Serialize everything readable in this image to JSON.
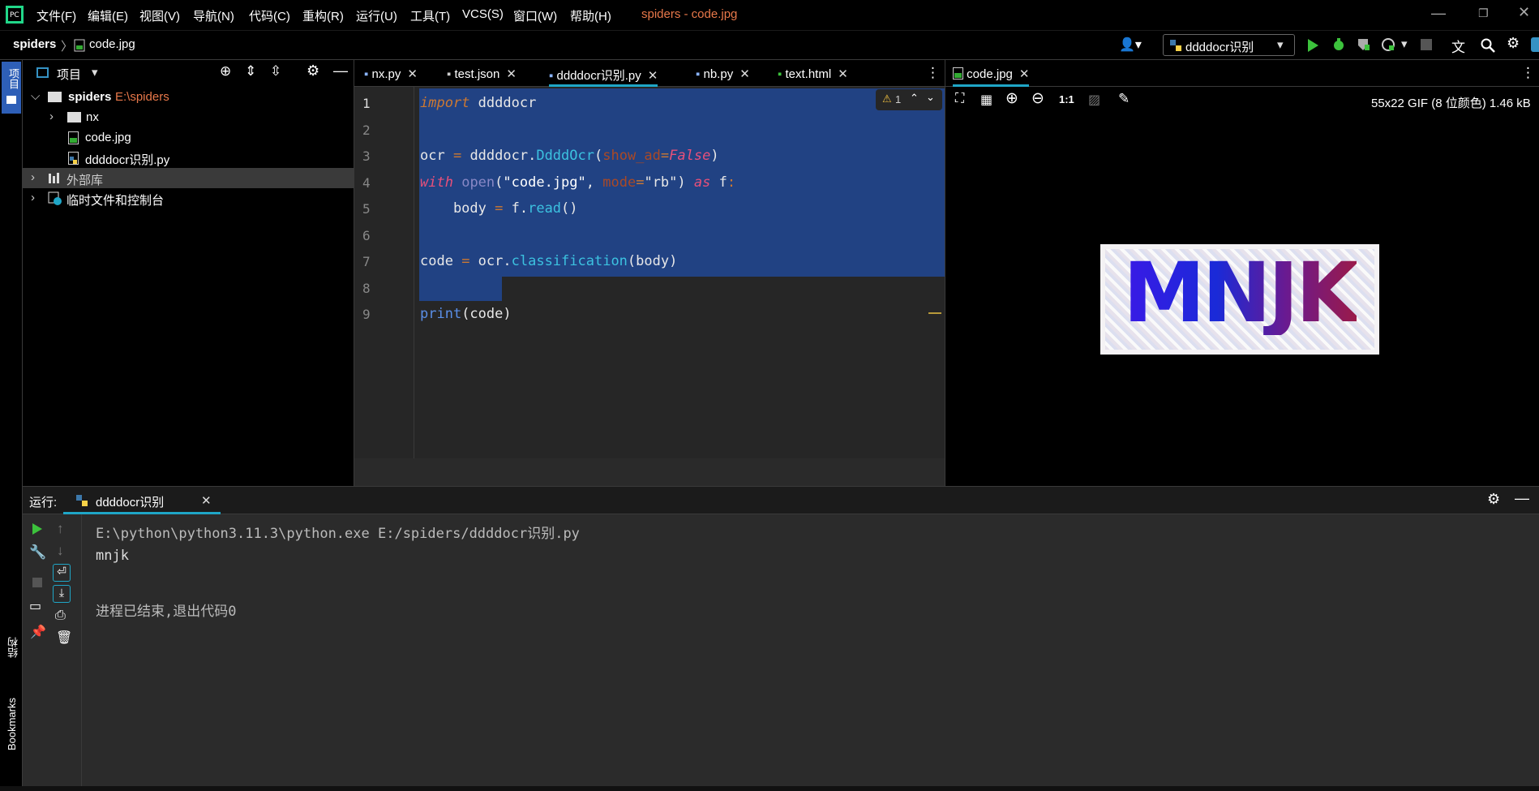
{
  "menu": [
    "文件(F)",
    "编辑(E)",
    "视图(V)",
    "导航(N)",
    "代码(C)",
    "重构(R)",
    "运行(U)",
    "工具(T)",
    "VCS(S)",
    "窗口(W)",
    "帮助(H)"
  ],
  "window_title": "spiders - code.jpg",
  "breadcrumb": {
    "root": "spiders",
    "file": "code.jpg"
  },
  "run_config": "ddddocr识别",
  "sidebar_left": {
    "project_tab": "项目",
    "structure_tab": "结构",
    "bookmarks_tab": "Bookmarks"
  },
  "project": {
    "title": "项目",
    "items": [
      {
        "label": "spiders",
        "path": "E:\\spiders"
      },
      {
        "label": "nx"
      },
      {
        "label": "code.jpg"
      },
      {
        "label": "ddddocr识别.py"
      },
      {
        "label": "外部库"
      },
      {
        "label": "临时文件和控制台"
      }
    ]
  },
  "editor": {
    "tabs": [
      "nx.py",
      "test.json",
      "ddddocr识别.py",
      "nb.py",
      "text.html"
    ],
    "warning_count": "1",
    "line_numbers": [
      "1",
      "2",
      "3",
      "4",
      "5",
      "6",
      "7",
      "8",
      "9"
    ]
  },
  "viewer": {
    "tab": "code.jpg",
    "zoom_actual": "1:1",
    "info": "55x22 GIF (8 位颜色) 1.46 kB",
    "captcha_text": "MNJK"
  },
  "run": {
    "label": "运行:",
    "tab": "ddddocr识别",
    "output": [
      "E:\\python\\python3.11.3\\python.exe E:/spiders/ddddocr识别.py",
      "mnjk",
      "",
      "进程已结束,退出代码0"
    ]
  },
  "colors": {
    "accent": "#3592c4",
    "selection": "#214283",
    "keyword": "#cc7832",
    "builtin": "#8888c6"
  }
}
